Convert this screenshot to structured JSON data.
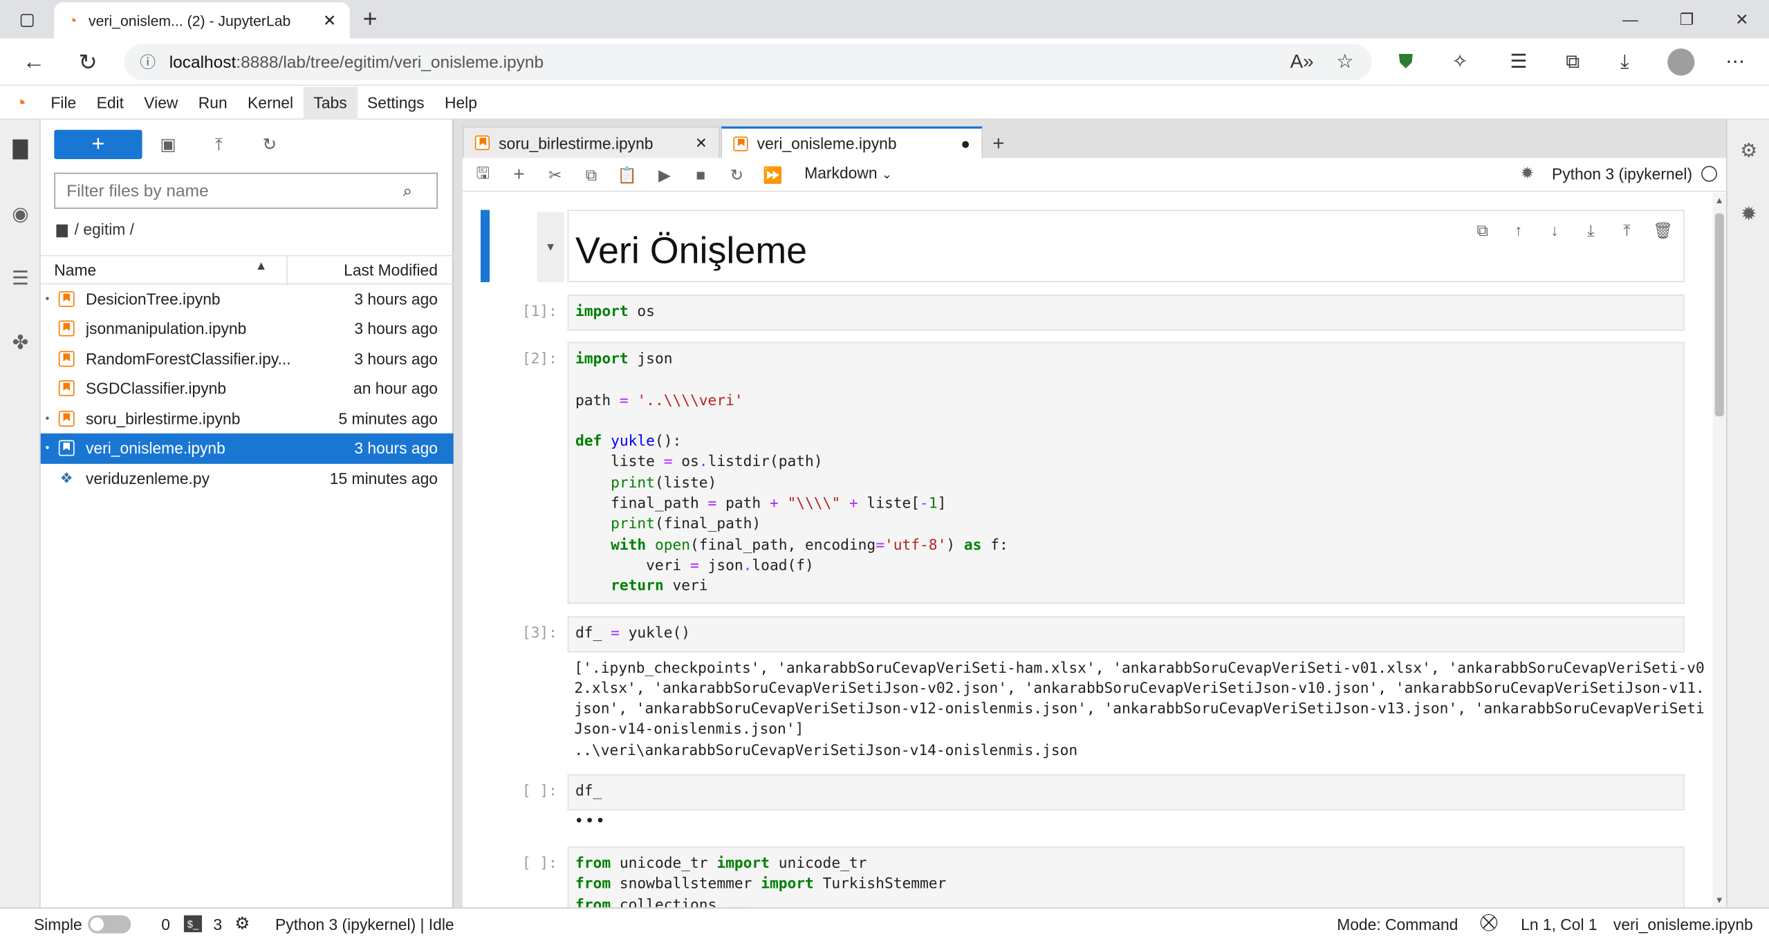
{
  "browser": {
    "tab_title": "veri_onislem... (2) - JupyterLab",
    "url_host": "localhost",
    "url_path": ":8888/lab/tree/egitim/veri_onisleme.ipynb"
  },
  "menu": [
    "File",
    "Edit",
    "View",
    "Run",
    "Kernel",
    "Tabs",
    "Settings",
    "Help"
  ],
  "filebrowser": {
    "filter_placeholder": "Filter files by name",
    "breadcrumb": "/ egitim /",
    "col_name": "Name",
    "col_modified": "Last Modified",
    "files": [
      {
        "name": "DesicionTree.ipynb",
        "modified": "3 hours ago",
        "running": true,
        "type": "notebook"
      },
      {
        "name": "jsonmanipulation.ipynb",
        "modified": "3 hours ago",
        "running": false,
        "type": "notebook"
      },
      {
        "name": "RandomForestClassifier.ipy...",
        "modified": "3 hours ago",
        "running": false,
        "type": "notebook"
      },
      {
        "name": "SGDClassifier.ipynb",
        "modified": "an hour ago",
        "running": false,
        "type": "notebook"
      },
      {
        "name": "soru_birlestirme.ipynb",
        "modified": "5 minutes ago",
        "running": true,
        "type": "notebook"
      },
      {
        "name": "veri_onisleme.ipynb",
        "modified": "3 hours ago",
        "running": true,
        "type": "notebook",
        "selected": true
      },
      {
        "name": "veriduzenleme.py",
        "modified": "15 minutes ago",
        "running": false,
        "type": "python"
      }
    ]
  },
  "doc_tabs": [
    {
      "title": "soru_birlestirme.ipynb",
      "active": false
    },
    {
      "title": "veri_onisleme.ipynb",
      "active": true
    }
  ],
  "notebook": {
    "cell_type": "Markdown",
    "kernel_name": "Python 3 (ipykernel)",
    "heading": "Veri Önişleme",
    "prompts": [
      "[1]:",
      "[2]:",
      "[3]:",
      "[ ]:",
      "[ ]:"
    ],
    "cell1": "import os",
    "output3_line1": "['.ipynb_checkpoints', 'ankarabbSoruCevapVeriSeti-ham.xlsx', 'ankarabbSoruCevapVeriSeti-v01.xlsx', 'ankarabbSoruCevapVeriSeti-v0",
    "output3_line2": "2.xlsx', 'ankarabbSoruCevapVeriSetiJson-v02.json', 'ankarabbSoruCevapVeriSetiJson-v10.json', 'ankarabbSoruCevapVeriSetiJson-v11.",
    "output3_line3": "json', 'ankarabbSoruCevapVeriSetiJson-v12-onislenmis.json', 'ankarabbSoruCevapVeriSetiJson-v13.json', 'ankarabbSoruCevapVeriSeti",
    "output3_line4": "Json-v14-onislenmis.json']",
    "output3_line5": "..\\veri\\ankarabbSoruCevapVeriSetiJson-v14-onislenmis.json",
    "cell4": "df_",
    "ellipsis": "•••"
  },
  "status": {
    "mode_label": "Simple",
    "count_a": "0",
    "count_b": "3",
    "kernel_status": "Python 3 (ipykernel) | Idle",
    "mode": "Mode: Command",
    "position": "Ln 1, Col 1",
    "filename": "veri_onisleme.ipynb"
  }
}
